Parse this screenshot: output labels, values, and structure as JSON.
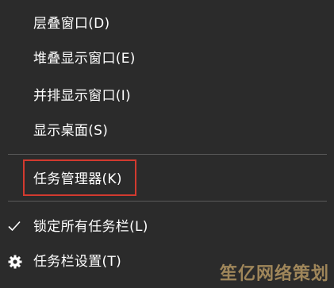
{
  "context_menu": {
    "items": [
      {
        "label": "层叠窗口(D)"
      },
      {
        "label": "堆叠显示窗口(E)"
      },
      {
        "label": "并排显示窗口(I)"
      },
      {
        "label": "显示桌面(S)"
      },
      {
        "label": "任务管理器(K)",
        "highlighted": true
      },
      {
        "label": "锁定所有任务栏(L)",
        "checked": true
      },
      {
        "label": "任务栏设置(T)",
        "icon": "gear-icon"
      }
    ]
  },
  "watermark": {
    "text": "笙亿网络策划"
  },
  "colors": {
    "background": "#2b2b2b",
    "text": "#ffffff",
    "divider": "#5a5a5a",
    "highlight_border": "#d23a2f"
  }
}
